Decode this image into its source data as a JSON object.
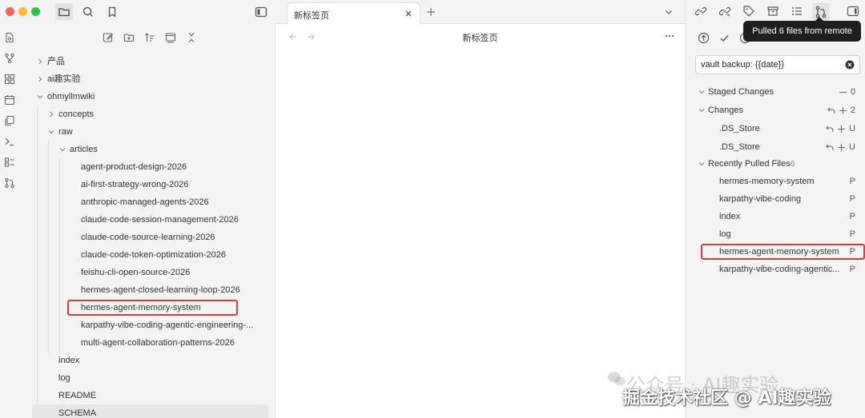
{
  "left_tree": [
    {
      "label": "产品",
      "indent": 0,
      "type": "folder",
      "expanded": false
    },
    {
      "label": "ai趣实验",
      "indent": 0,
      "type": "folder",
      "expanded": false
    },
    {
      "label": "ohmyllmwiki",
      "indent": 0,
      "type": "folder",
      "expanded": true
    },
    {
      "label": "concepts",
      "indent": 1,
      "type": "folder",
      "expanded": false
    },
    {
      "label": "raw",
      "indent": 1,
      "type": "folder",
      "expanded": true
    },
    {
      "label": "articles",
      "indent": 2,
      "type": "folder",
      "expanded": true
    },
    {
      "label": "agent-product-design-2026",
      "indent": 3,
      "type": "file"
    },
    {
      "label": "ai-first-strategy-wrong-2026",
      "indent": 3,
      "type": "file"
    },
    {
      "label": "anthropic-managed-agents-2026",
      "indent": 3,
      "type": "file"
    },
    {
      "label": "claude-code-session-management-2026",
      "indent": 3,
      "type": "file"
    },
    {
      "label": "claude-code-source-learning-2026",
      "indent": 3,
      "type": "file"
    },
    {
      "label": "claude-code-token-optimization-2026",
      "indent": 3,
      "type": "file"
    },
    {
      "label": "feishu-cli-open-source-2026",
      "indent": 3,
      "type": "file"
    },
    {
      "label": "hermes-agent-closed-learning-loop-2026",
      "indent": 3,
      "type": "file"
    },
    {
      "label": "hermes-agent-memory-system",
      "indent": 3,
      "type": "file",
      "highlighted": true
    },
    {
      "label": "karpathy-vibe-coding-agentic-engineering-...",
      "indent": 3,
      "type": "file"
    },
    {
      "label": "multi-agent-collaboration-patterns-2026",
      "indent": 3,
      "type": "file"
    },
    {
      "label": "index",
      "indent": 1,
      "type": "file"
    },
    {
      "label": "log",
      "indent": 1,
      "type": "file"
    },
    {
      "label": "README",
      "indent": 1,
      "type": "file"
    },
    {
      "label": "SCHEMA",
      "indent": 1,
      "type": "file",
      "selected": true
    }
  ],
  "center": {
    "tab_label": "新标签页",
    "view_title": "新标签页"
  },
  "git": {
    "tooltip": "Pulled 6 files from remote",
    "commit_message": "vault backup: {{date}}",
    "staged": {
      "label": "Staged Changes",
      "count": "0"
    },
    "changes": {
      "label": "Changes",
      "count": "2",
      "files": [
        {
          "name": ".DS_Store",
          "status": "U"
        },
        {
          "name": ".DS_Store",
          "status": "U"
        }
      ]
    },
    "recent": {
      "label": "Recently Pulled Files",
      "count": "6",
      "files": [
        {
          "name": "hermes-memory-system",
          "status": "P"
        },
        {
          "name": "karpathy-vibe-coding",
          "status": "P"
        },
        {
          "name": "index",
          "status": "P"
        },
        {
          "name": "log",
          "status": "P"
        },
        {
          "name": "hermes-agent-memory-system",
          "status": "P",
          "highlighted": true
        },
        {
          "name": "karpathy-vibe-coding-agentic...",
          "status": "P"
        }
      ]
    }
  },
  "watermark": {
    "line1": "公众号 · AI趣实验",
    "line2": "掘金技术社区 @ AI趣实验"
  },
  "colors": {
    "highlight": "#e03a3a",
    "sidebar_bg": "#f4f4f4",
    "tooltip_bg": "#1f1f1f"
  }
}
